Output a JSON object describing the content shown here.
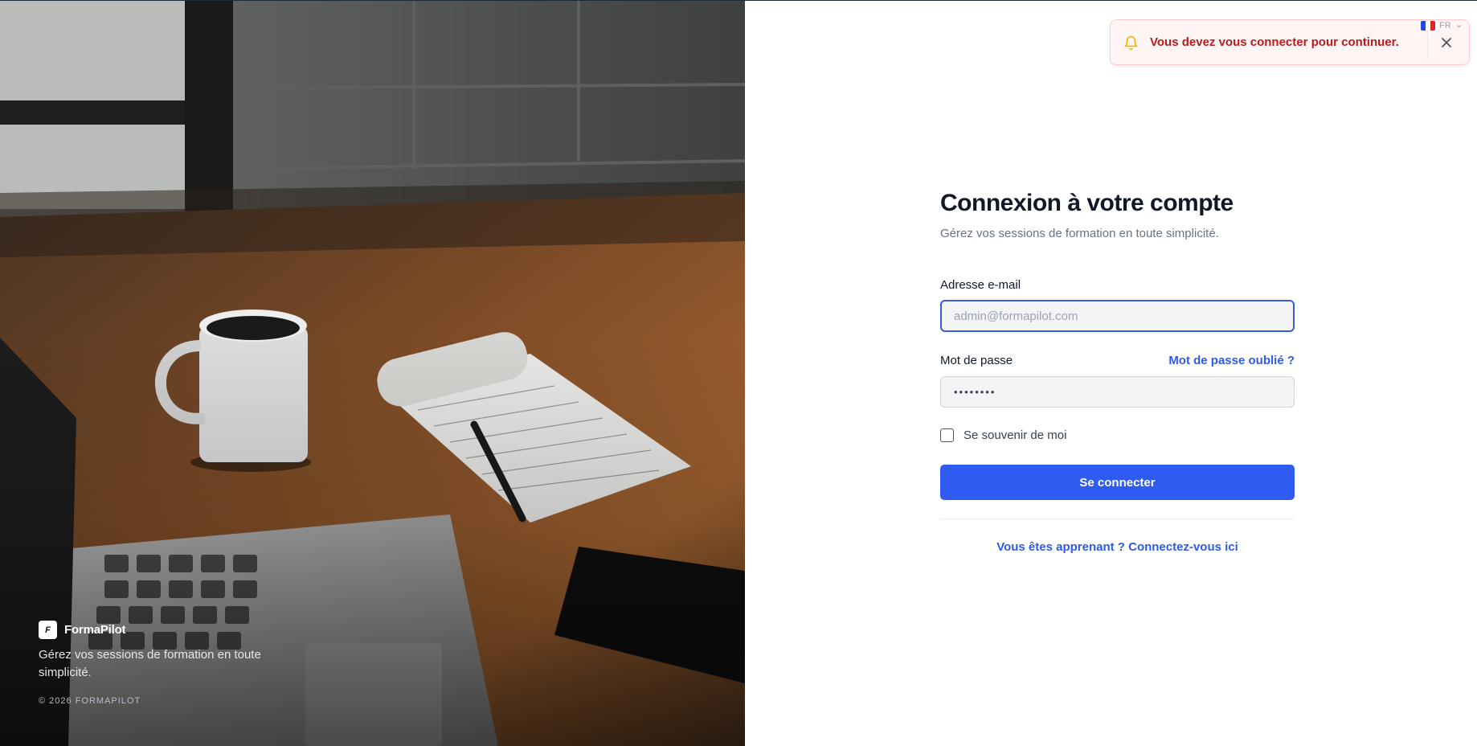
{
  "colors": {
    "primary": "#2f5bf0",
    "link": "#2f5bea",
    "toast_text": "#b91c1c",
    "toast_bg": "#fff5f5",
    "bell": "#eab308"
  },
  "hero": {
    "image": "desk-laptop-coffee-notepad-photo",
    "logo_letter": "F",
    "brand_name": "FormaPilot",
    "tagline": "Gérez vos sessions de formation en toute simplicité.",
    "copyright": "© 2026 FORMAPILOT"
  },
  "toast": {
    "icon": "bell-icon",
    "message": "Vous devez vous connecter pour continuer.",
    "close_icon": "close-icon"
  },
  "language": {
    "flag": "fr-flag",
    "code": "FR"
  },
  "login": {
    "title": "Connexion à votre compte",
    "subtitle": "Gérez vos sessions de formation en toute simplicité.",
    "email_label": "Adresse e-mail",
    "email_placeholder": "admin@formapilot.com",
    "email_value": "",
    "password_label": "Mot de passe",
    "forgot_link": "Mot de passe oublié ?",
    "password_masked": "••••••••",
    "remember_label": "Se souvenir de moi",
    "remember_checked": false,
    "submit_label": "Se connecter",
    "learner_link": "Vous êtes apprenant ? Connectez-vous ici"
  }
}
